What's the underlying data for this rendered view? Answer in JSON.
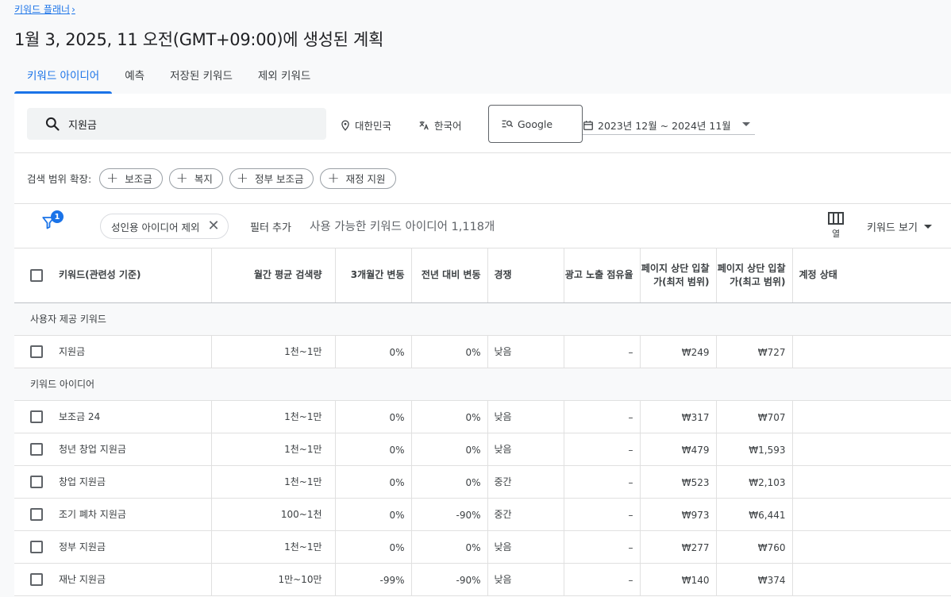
{
  "breadcrumb": {
    "label": "키워드 플래너",
    "chevron": "›"
  },
  "page_title": "1월 3, 2025, 11 오전(GMT+09:00)에 생성된 계획",
  "tabs": [
    {
      "label": "키워드 아이디어",
      "active": true
    },
    {
      "label": "예측",
      "active": false
    },
    {
      "label": "저장된 키워드",
      "active": false
    },
    {
      "label": "제외 키워드",
      "active": false
    }
  ],
  "search": {
    "value": "지원금",
    "location": "대한민국",
    "language": "한국어",
    "network": "Google",
    "date_range": "2023년 12월 ~ 2024년 11월"
  },
  "expand": {
    "label": "검색 범위 확장:",
    "chips": [
      "보조금",
      "복지",
      "정부 보조금",
      "재정 지원"
    ]
  },
  "filters": {
    "badge": "1",
    "active_filter": "성인용 아이디어 제외",
    "add_filter": "필터 추가",
    "available": "사용 가능한 키워드 아이디어 1,118개",
    "columns_label": "열",
    "view_label": "키워드 보기"
  },
  "table": {
    "headers": {
      "keyword": "키워드(관련성 기준)",
      "volume": "월간 평균 검색량",
      "change3m": "3개월간 변동",
      "yoy": "전년 대비 변동",
      "competition": "경쟁",
      "impr_share": "광고 노출 점유율",
      "bid_low": "페이지 상단 입찰가(최저 범위)",
      "bid_high": "페이지 상단 입찰가(최고 범위)",
      "status": "계정 상태"
    },
    "section_user": "사용자 제공 키워드",
    "section_ideas": "키워드 아이디어",
    "user_rows": [
      {
        "keyword": "지원금",
        "volume": "1천~1만",
        "change3m": "0%",
        "yoy": "0%",
        "competition": "낮음",
        "impr_share": "–",
        "bid_low": "₩249",
        "bid_high": "₩727"
      }
    ],
    "idea_rows": [
      {
        "keyword": "보조금 24",
        "volume": "1천~1만",
        "change3m": "0%",
        "yoy": "0%",
        "competition": "낮음",
        "impr_share": "–",
        "bid_low": "₩317",
        "bid_high": "₩707"
      },
      {
        "keyword": "청년 창업 지원금",
        "volume": "1천~1만",
        "change3m": "0%",
        "yoy": "0%",
        "competition": "낮음",
        "impr_share": "–",
        "bid_low": "₩479",
        "bid_high": "₩1,593"
      },
      {
        "keyword": "창업 지원금",
        "volume": "1천~1만",
        "change3m": "0%",
        "yoy": "0%",
        "competition": "중간",
        "impr_share": "–",
        "bid_low": "₩523",
        "bid_high": "₩2,103"
      },
      {
        "keyword": "조기 폐차 지원금",
        "volume": "100~1천",
        "change3m": "0%",
        "yoy": "-90%",
        "competition": "중간",
        "impr_share": "–",
        "bid_low": "₩973",
        "bid_high": "₩6,441"
      },
      {
        "keyword": "정부 지원금",
        "volume": "1천~1만",
        "change3m": "0%",
        "yoy": "0%",
        "competition": "낮음",
        "impr_share": "–",
        "bid_low": "₩277",
        "bid_high": "₩760"
      },
      {
        "keyword": "재난 지원금",
        "volume": "1만~10만",
        "change3m": "-99%",
        "yoy": "-90%",
        "competition": "낮음",
        "impr_share": "–",
        "bid_low": "₩140",
        "bid_high": "₩374"
      }
    ]
  }
}
